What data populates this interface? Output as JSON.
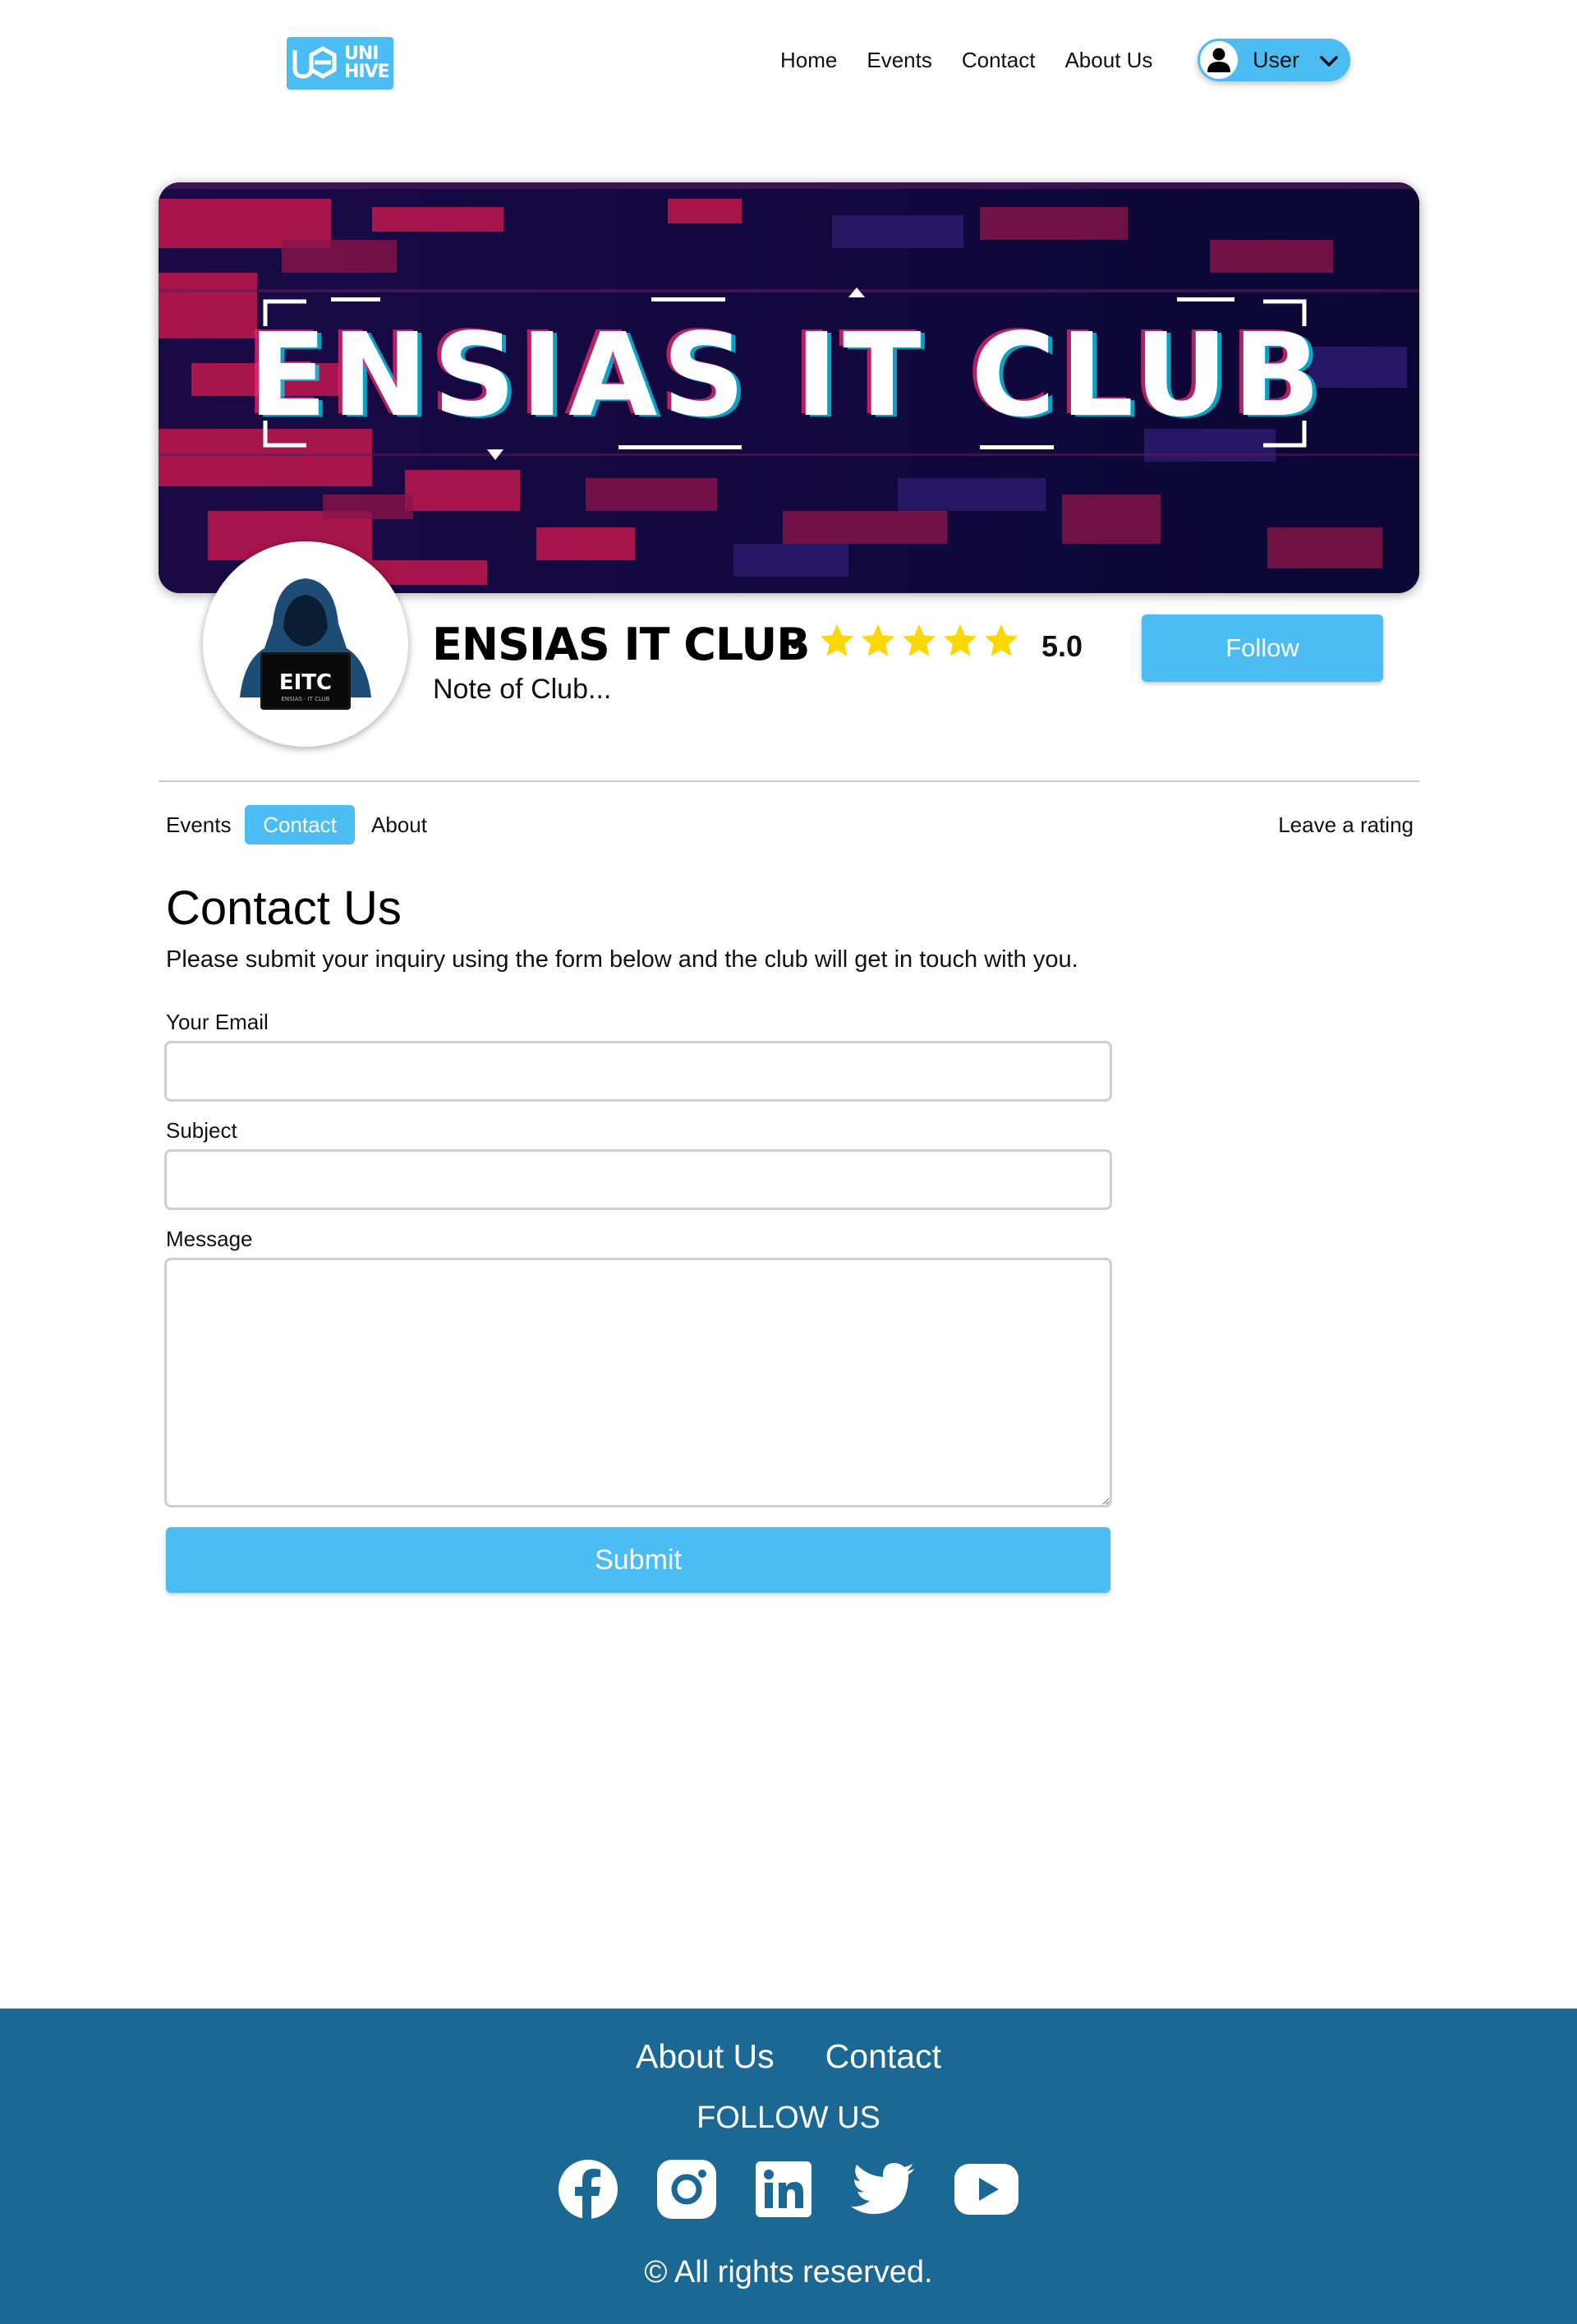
{
  "header": {
    "logo_text_line1": "UNI",
    "logo_text_line2": "HIVE",
    "nav": [
      "Home",
      "Events",
      "Contact",
      "About Us"
    ],
    "user_label": "User"
  },
  "banner": {
    "title_text": "ENSIAS IT CLUB"
  },
  "club": {
    "logo_text": "EITC",
    "logo_subtext": "ENSIAS · IT CLUB",
    "name": "ENSIAS IT CLUB",
    "rating": 5.0,
    "rating_display": "5.0",
    "star_color": "#ffd700",
    "note": "Note of Club...",
    "follow_label": "Follow"
  },
  "tabs": {
    "events": "Events",
    "contact": "Contact",
    "about": "About",
    "active": "Contact",
    "leave_rating": "Leave a rating"
  },
  "contact": {
    "title": "Contact Us",
    "description": "Please submit your inquiry using the form below and the club will get in touch with you.",
    "email_label": "Your Email",
    "email_value": "",
    "subject_label": "Subject",
    "subject_value": "",
    "message_label": "Message",
    "message_value": "",
    "submit_label": "Submit"
  },
  "footer": {
    "links": [
      "About Us",
      "Contact"
    ],
    "follow_us": "FOLLOW US",
    "socials": [
      "facebook-icon",
      "instagram-icon",
      "linkedin-icon",
      "twitter-icon",
      "youtube-icon"
    ],
    "copyright": "© All rights reserved."
  },
  "colors": {
    "accent": "#4cbdf3",
    "footer_bg": "#1a6893",
    "banner_dark": "#0d0738",
    "banner_red": "#c2184d"
  }
}
